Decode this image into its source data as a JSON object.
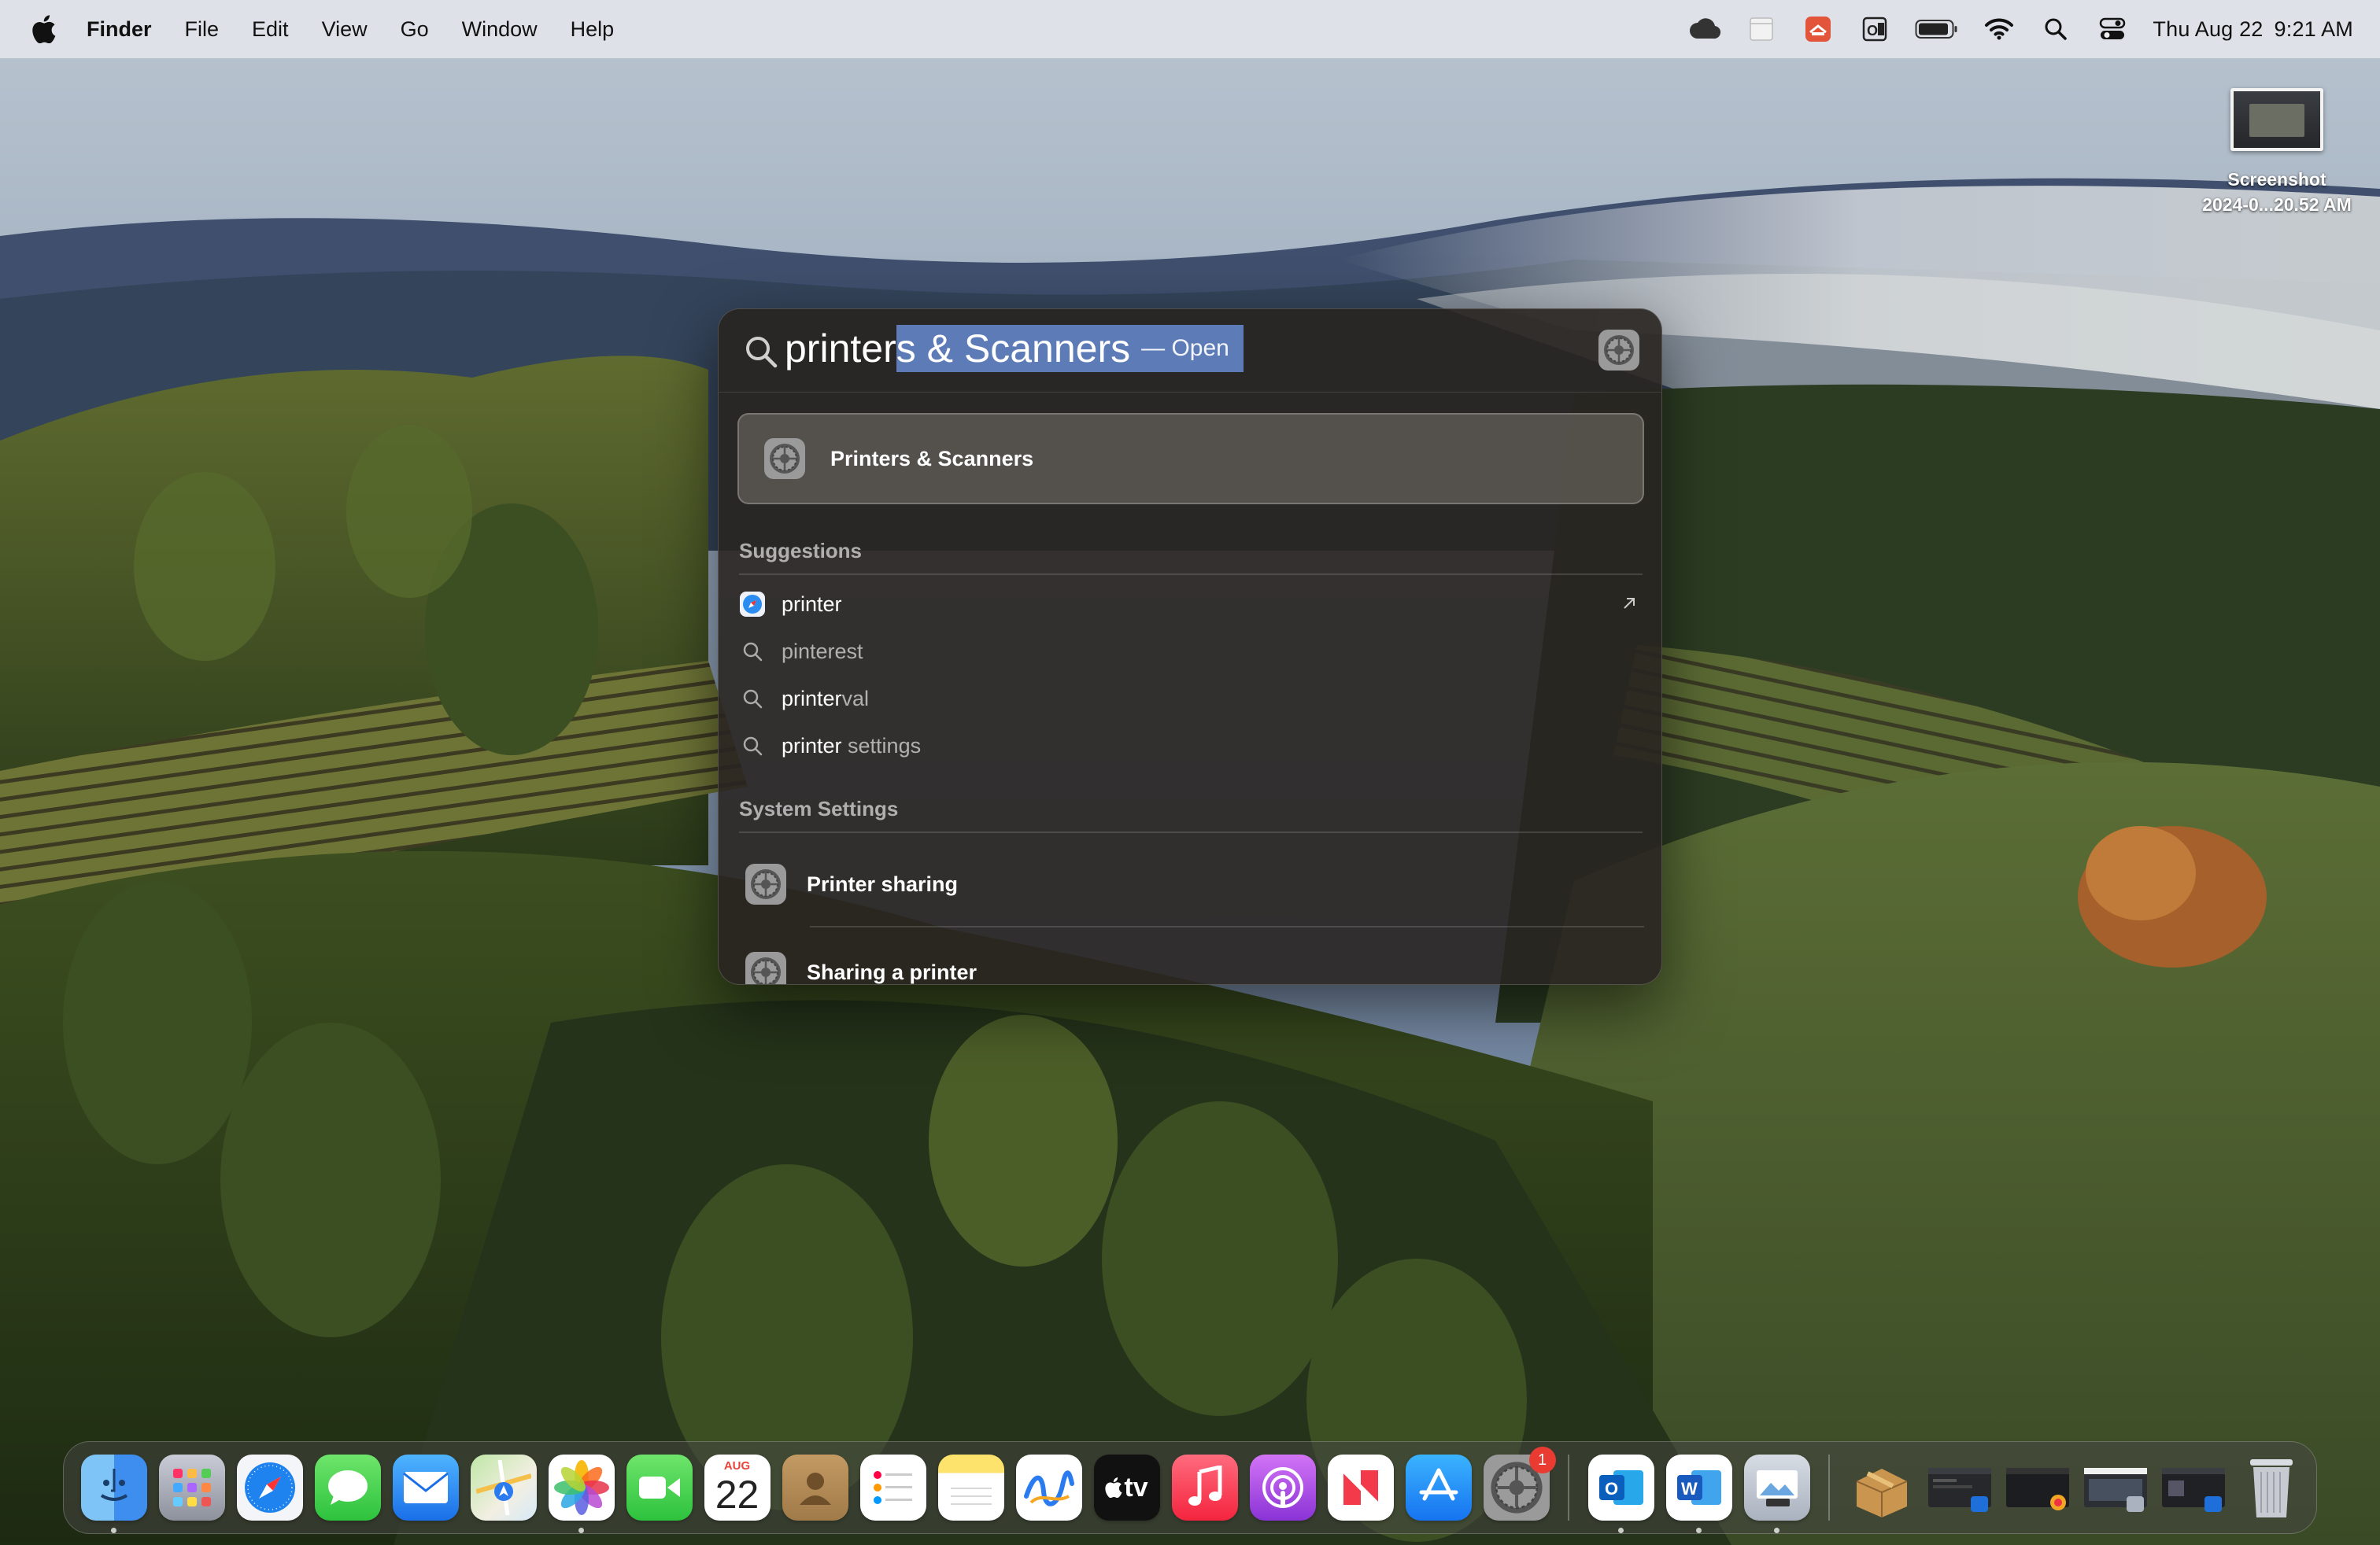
{
  "menubar": {
    "app_name": "Finder",
    "menus": [
      "File",
      "Edit",
      "View",
      "Go",
      "Window",
      "Help"
    ],
    "status_icons": [
      "creative-cloud-icon",
      "document-icon",
      "airdrop-app-icon",
      "outlook-status-icon",
      "battery-icon",
      "wifi-icon",
      "spotlight-icon",
      "control-center-icon"
    ],
    "date": "Thu Aug 22",
    "time": "9:21 AM"
  },
  "desktop": {
    "file_label_line1": "Screenshot",
    "file_label_line2": "2024-0...20.52 AM"
  },
  "spotlight": {
    "query_typed": "printer",
    "query_s": "s",
    "query_completion": " & Scanners",
    "open_hint": "— Open",
    "top_hit": "Printers & Scanners",
    "suggestions_title": "Suggestions",
    "suggestions": [
      {
        "typed": "printer",
        "rest": "",
        "icon": "safari-icon"
      },
      {
        "typed": "",
        "rest": "pinterest",
        "icon": "search-icon"
      },
      {
        "typed": "printer",
        "rest": "val",
        "icon": "search-icon"
      },
      {
        "typed": "printer",
        "rest": " settings",
        "icon": "search-icon"
      }
    ],
    "system_settings_title": "System Settings",
    "system_settings_results": [
      "Printer sharing",
      "Sharing a printer"
    ]
  },
  "dock": {
    "calendar_month": "AUG",
    "calendar_day": "22",
    "tv_label": "tv",
    "settings_badge": "1",
    "word_letter": "W",
    "outlook_letter": "O"
  },
  "colors": {
    "selection": "#6080be",
    "spotlight_bg": "#282420",
    "badge": "#ea3b32"
  }
}
